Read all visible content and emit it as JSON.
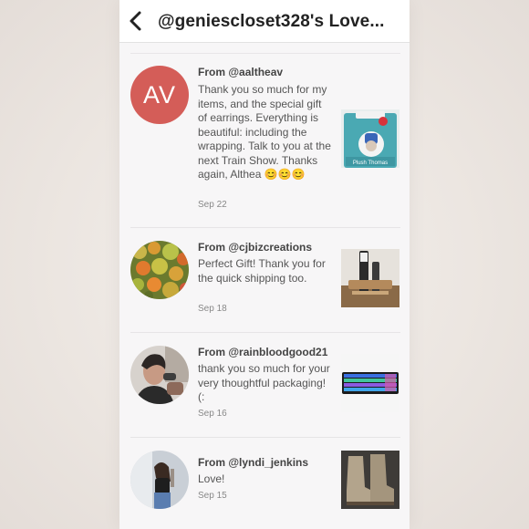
{
  "header": {
    "title": "@geniescloset328's Love..."
  },
  "reviews": [
    {
      "from": "From @aaltheav",
      "avatar_initials": "AV",
      "message": "Thank you so much for my items, and the special gift of earrings. Everything is beautiful: including the wrapping. Talk to you at the next Train Show. Thanks again, Althea 😊😊😊",
      "date": "Sep 22",
      "thumb_label": "Plush Thomas"
    },
    {
      "from": "From @cjbizcreations",
      "message": "Perfect Gift! Thank you for the quick shipping too.",
      "date": "Sep 18"
    },
    {
      "from": "From @rainbloodgood21",
      "message": "thank you so much for your very thoughtful packaging! (:",
      "date": "Sep 16"
    },
    {
      "from": "From @lyndi_jenkins",
      "message": "Love!",
      "date": "Sep 15"
    }
  ]
}
